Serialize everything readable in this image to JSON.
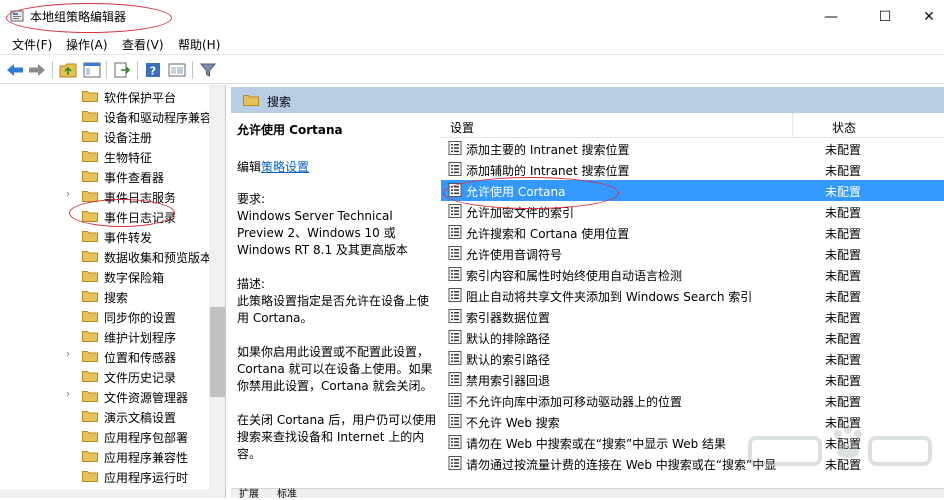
{
  "window": {
    "title": "本地组策略编辑器",
    "min_glyph": "—",
    "max_glyph": "☐",
    "close_glyph": "✕"
  },
  "menu": [
    "文件(F)",
    "操作(A)",
    "查看(V)",
    "帮助(H)"
  ],
  "toolbar": {
    "icons": [
      "back-arrow-icon",
      "forward-arrow-icon",
      "up-folder-icon",
      "show-hide-tree-icon",
      "export-list-icon",
      "help-icon",
      "console-view-icon",
      "filter-icon"
    ]
  },
  "tree": {
    "items": [
      {
        "label": "软件保护平台",
        "expandable": false
      },
      {
        "label": "设备和驱动程序兼容",
        "expandable": false
      },
      {
        "label": "设备注册",
        "expandable": false
      },
      {
        "label": "生物特征",
        "expandable": false
      },
      {
        "label": "事件查看器",
        "expandable": false
      },
      {
        "label": "事件日志服务",
        "expandable": true
      },
      {
        "label": "事件日志记录",
        "expandable": false
      },
      {
        "label": "事件转发",
        "expandable": false
      },
      {
        "label": "数据收集和预览版本",
        "expandable": false
      },
      {
        "label": "数字保险箱",
        "expandable": false
      },
      {
        "label": "搜索",
        "expandable": false
      },
      {
        "label": "同步你的设置",
        "expandable": false
      },
      {
        "label": "维护计划程序",
        "expandable": false
      },
      {
        "label": "位置和传感器",
        "expandable": true
      },
      {
        "label": "文件历史记录",
        "expandable": false
      },
      {
        "label": "文件资源管理器",
        "expandable": true
      },
      {
        "label": "演示文稿设置",
        "expandable": false
      },
      {
        "label": "应用程序包部署",
        "expandable": false
      },
      {
        "label": "应用程序兼容性",
        "expandable": false
      },
      {
        "label": "应用程序运行时",
        "expandable": false
      }
    ]
  },
  "pane": {
    "header": "搜索"
  },
  "description": {
    "title": "允许使用 Cortana",
    "edit_prefix": "编辑",
    "edit_link": "策略设置",
    "requirements": "要求:\nWindows Server Technical Preview 2、Windows 10 或 Windows RT 8.1 及其更高版本",
    "summary": "描述:\n此策略设置指定是否允许在设备上使用 Cortana。",
    "detail1": "如果你启用此设置或不配置此设置，Cortana 就可以在设备上使用。如果你禁用此设置，Cortana 就会关闭。",
    "detail2": "在关闭 Cortana 后，用户仍可以使用搜索来查找设备和 Internet 上的内容。"
  },
  "list": {
    "col_setting": "设置",
    "col_status": "状态",
    "selected_index": 2,
    "rows": [
      {
        "name": "添加主要的 Intranet 搜索位置",
        "status": "未配置"
      },
      {
        "name": "添加辅助的 Intranet 搜索位置",
        "status": "未配置"
      },
      {
        "name": "允许使用 Cortana",
        "status": "未配置"
      },
      {
        "name": "允许加密文件的索引",
        "status": "未配置"
      },
      {
        "name": "允许搜索和 Cortana 使用位置",
        "status": "未配置"
      },
      {
        "name": "允许使用音调符号",
        "status": "未配置"
      },
      {
        "name": "索引内容和属性时始终使用自动语言检测",
        "status": "未配置"
      },
      {
        "name": "阻止自动将共享文件夹添加到 Windows Search 索引",
        "status": "未配置"
      },
      {
        "name": "索引器数据位置",
        "status": "未配置"
      },
      {
        "name": "默认的排除路径",
        "status": "未配置"
      },
      {
        "name": "默认的索引路径",
        "status": "未配置"
      },
      {
        "name": "禁用索引器回退",
        "status": "未配置"
      },
      {
        "name": "不允许向库中添加可移动驱动器上的位置",
        "status": "未配置"
      },
      {
        "name": "不允许 Web 搜索",
        "status": "未配置"
      },
      {
        "name": "请勿在 Web 中搜索或在“搜索”中显示 Web 结果",
        "status": "未配置"
      },
      {
        "name": "请勿通过按流量计费的连接在 Web 中搜索或在“搜索”中显",
        "status": "未配置"
      }
    ]
  },
  "tabs": [
    "扩展",
    "标准"
  ],
  "colors": {
    "header_bg": "#b9cde5",
    "selection": "#3399ff",
    "annotation": "#d8303c",
    "link": "#0563c1"
  }
}
